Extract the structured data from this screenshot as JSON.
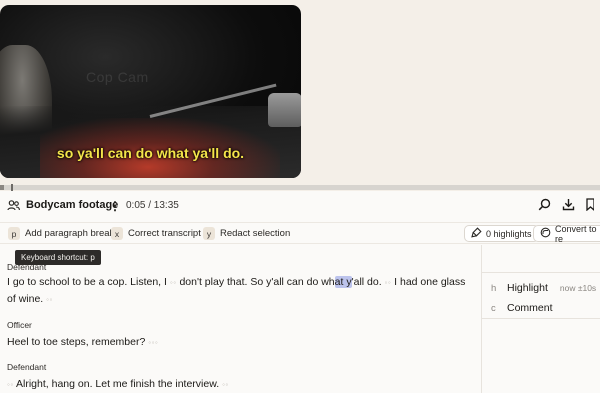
{
  "video": {
    "caption": "so ya'll can do what ya'll do.",
    "watermark": "Cop Cam"
  },
  "progress": {
    "fraction": 0.0063
  },
  "header": {
    "title": "Bodycam footage",
    "time": "0:05 / 13:35",
    "icons": [
      "users-icon",
      "more-vertical-icon",
      "search-icon",
      "download-icon",
      "bookmark-icon"
    ]
  },
  "toolbar": {
    "add_paragraph": {
      "key": "p",
      "label": "Add paragraph break"
    },
    "correct": {
      "key": "x",
      "label": "Correct transcript"
    },
    "redact": {
      "key": "y",
      "label": "Redact selection"
    },
    "highlights": "0 highlights",
    "convert": "Convert to re"
  },
  "tooltip": "Keyboard shortcut: p",
  "transcript": [
    {
      "speaker": "Defendant",
      "seg1": "I go to school to be a cop. Listen, I",
      "seg2": "don't play that. So y'all can do wh",
      "seg3": "at y",
      "seg4": "'all do.",
      "seg5": "I had one glass of",
      "seg6": "wine."
    },
    {
      "speaker": "Officer",
      "seg1": "Heel to toe steps, remember?"
    },
    {
      "speaker": "Defendant",
      "seg1": "Alright, hang on. Let me finish the interview."
    }
  ],
  "side_menu": {
    "highlight": {
      "key": "h",
      "label": "Highlight",
      "hint": "now ±10s"
    },
    "comment": {
      "key": "c",
      "label": "Comment"
    }
  }
}
